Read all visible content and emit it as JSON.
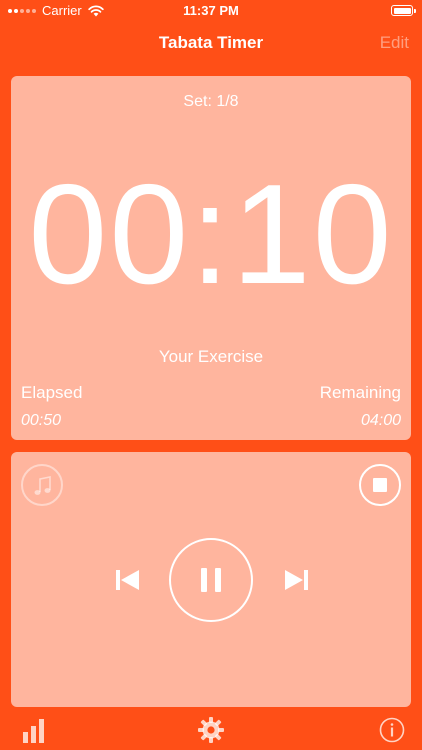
{
  "status_bar": {
    "carrier": "Carrier",
    "time": "11:37 PM",
    "icons": [
      "signal-dots",
      "wifi-icon",
      "battery-icon"
    ]
  },
  "nav": {
    "title": "Tabata Timer",
    "edit_label": "Edit"
  },
  "timer": {
    "set_label": "Set: 1/8",
    "time": "00:10",
    "exercise": "Your Exercise",
    "elapsed_label": "Elapsed",
    "elapsed_value": "00:50",
    "remaining_label": "Remaining",
    "remaining_value": "04:00"
  },
  "controls": {
    "icons": [
      "music-note-icon",
      "stop-icon",
      "previous-icon",
      "pause-icon",
      "next-icon"
    ]
  },
  "tab_bar": {
    "icons": [
      "bar-chart-icon",
      "gear-icon",
      "info-icon"
    ]
  },
  "colors": {
    "background": "#FF4F17",
    "card": "#FFB59E",
    "foreground": "#FFFFFF"
  }
}
